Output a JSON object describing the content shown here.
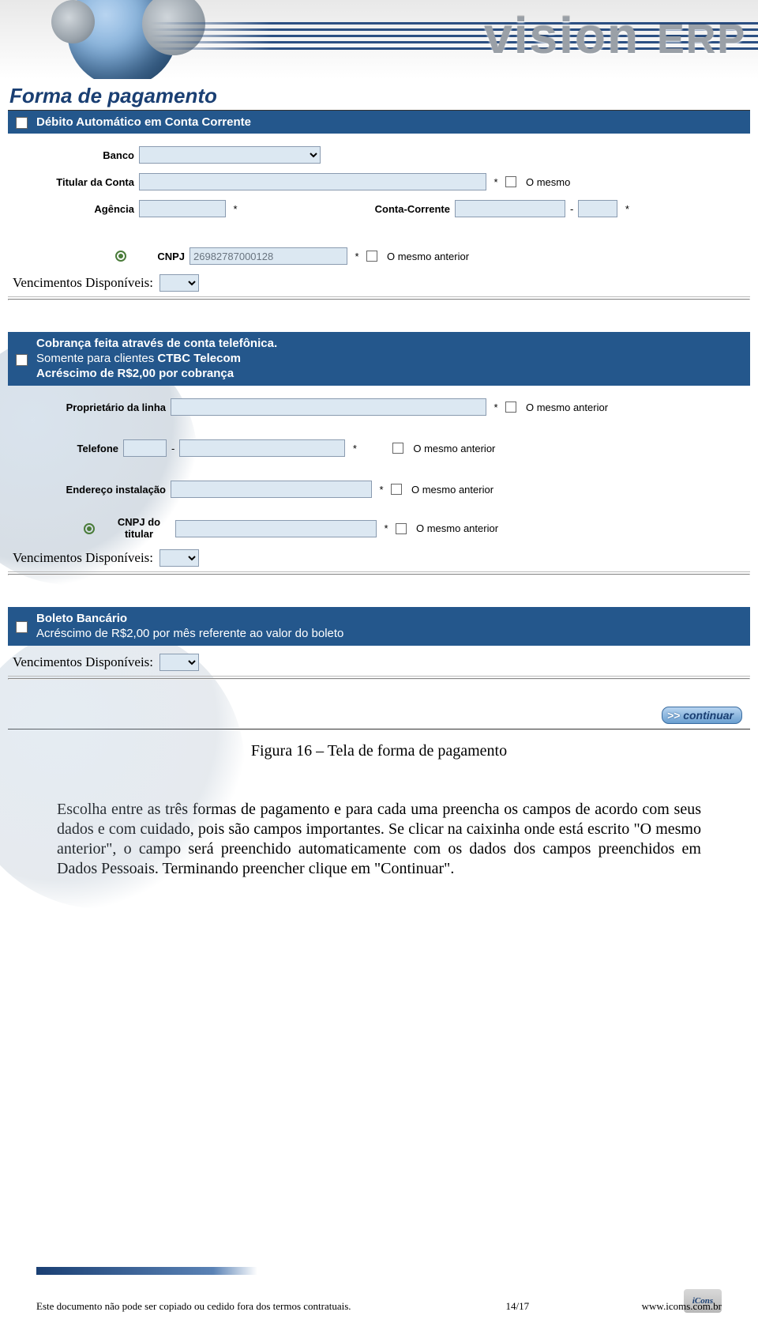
{
  "brand": {
    "name": "vision",
    "sub": "ERP"
  },
  "section_title": "Forma de pagamento",
  "debit": {
    "title": "Débito Automático em Conta Corrente",
    "bank_label": "Banco",
    "holder_label": "Titular da Conta",
    "same_label": "O mesmo",
    "agency_label": "Agência",
    "account_label": "Conta-Corrente",
    "cnpj_label": "CNPJ",
    "cnpj_value": "26982787000128",
    "same_prev": "O mesmo anterior"
  },
  "venc_label": "Vencimentos Disponíveis:",
  "phone_billing": {
    "line1": "Cobrança feita através de conta telefônica.",
    "line2a": "Somente para clientes ",
    "line2b": "CTBC Telecom",
    "line3": "Acréscimo de R$2,00 por cobrança",
    "owner_label": "Proprietário da linha",
    "phone_label": "Telefone",
    "addr_label": "Endereço instalação",
    "cnpj_label": "CNPJ do titular",
    "same_prev": "O mesmo anterior"
  },
  "boleto": {
    "line1": "Boleto Bancário",
    "line2": "Acréscimo de R$2,00 por mês referente ao valor do boleto"
  },
  "continuar": "continuar",
  "caption": "Figura 16 – Tela de forma de pagamento",
  "body": "Escolha entre as três formas de pagamento e para cada uma preencha os campos de acordo com seus dados e com cuidado, pois são campos importantes. Se clicar na caixinha onde está escrito \"O mesmo anterior\", o campo será preenchido automaticamente com os dados dos campos preenchidos em Dados Pessoais. Terminando preencher clique em \"Continuar\".",
  "footer": {
    "disclaimer": "Este documento não pode ser copiado ou cedido fora dos termos contratuais.",
    "page": "14/17",
    "url": "www.icoms.com.br"
  }
}
